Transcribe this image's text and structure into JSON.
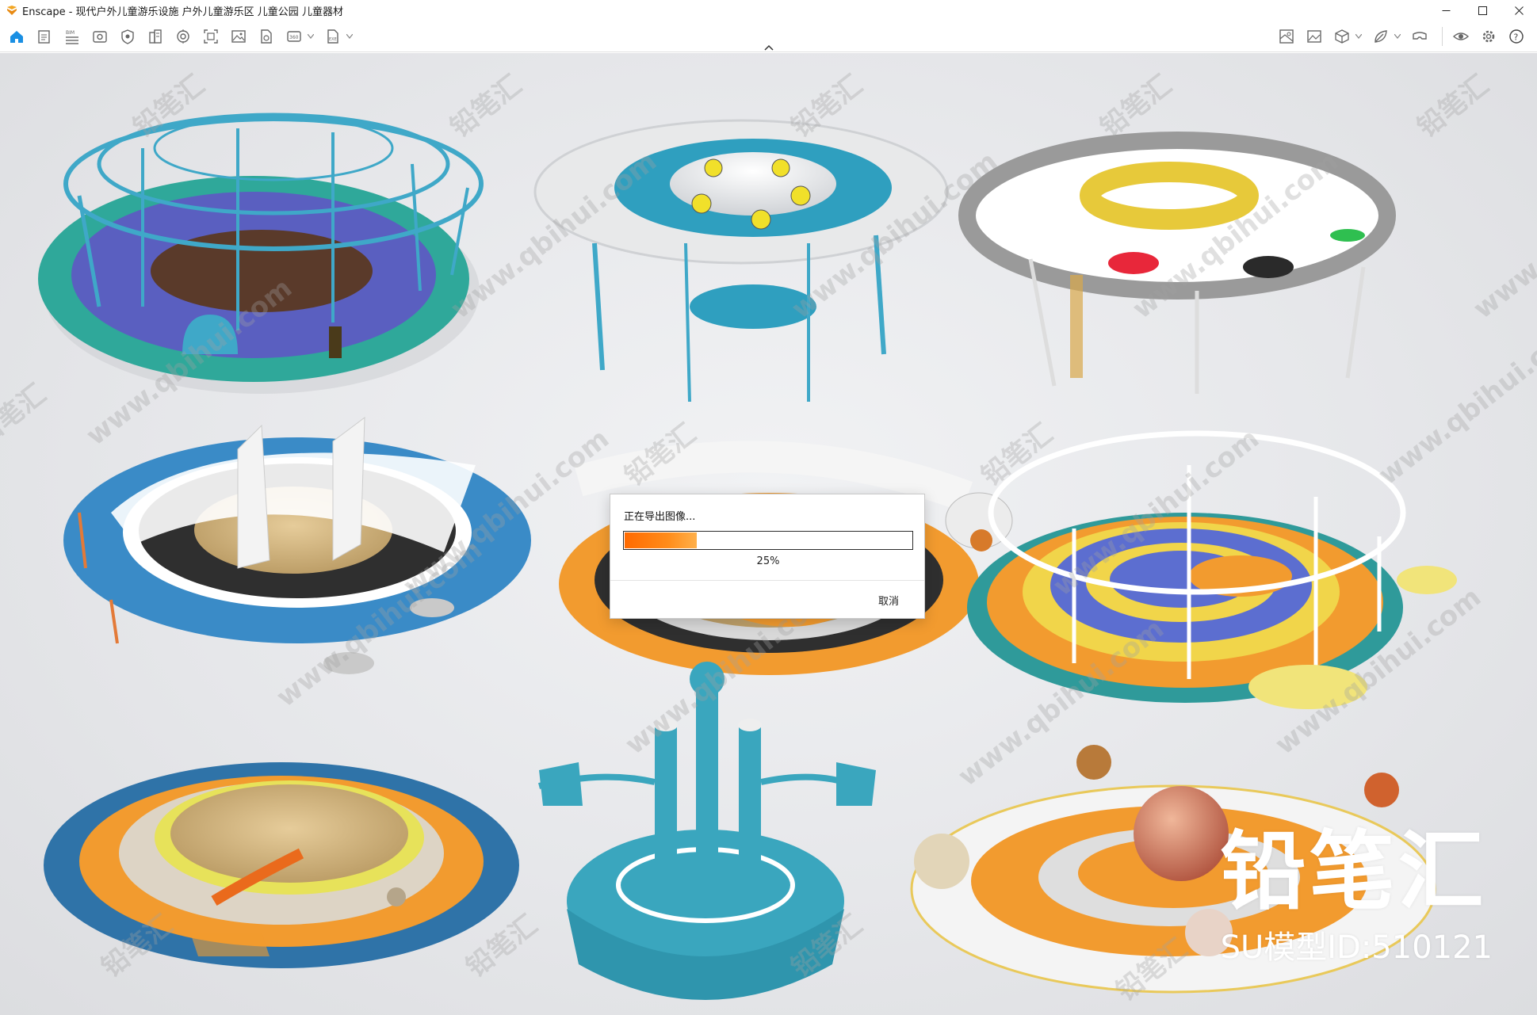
{
  "window": {
    "app_name": "Enscape",
    "title": "Enscape - 现代户外儿童游乐设施 户外儿童游乐区 儿童公园 儿童器材",
    "controls": [
      "minimize-icon",
      "maximize-icon",
      "close-icon"
    ]
  },
  "toolbar": {
    "left_icons": [
      "home-icon",
      "document-icon",
      "bim-icon",
      "visibility-icon",
      "views-icon",
      "building-icon",
      "asset-library-icon",
      "screenshot-icon",
      "gallery-icon",
      "file-icon",
      "panorama-360-icon",
      "exe-export-icon"
    ],
    "right_icons": [
      "material-editor-icon",
      "image-icon",
      "box-icon",
      "leaf-icon",
      "vr-headset-icon",
      "eye-icon",
      "settings-icon",
      "help-icon"
    ]
  },
  "dialog": {
    "title": "正在导出图像...",
    "progress": 0.25,
    "progress_text": "25%",
    "cancel_label": "取消"
  },
  "watermark": {
    "cn": "铅笔汇",
    "url": "www.qbihui.com",
    "brand": "铅笔汇",
    "model_id": "SU模型ID:510121"
  },
  "colors": {
    "teal": "#3aa6be",
    "orange": "#f29b2f",
    "yellow": "#f1d54a",
    "purple": "#6f74c9",
    "progress": "#ff7a00"
  }
}
